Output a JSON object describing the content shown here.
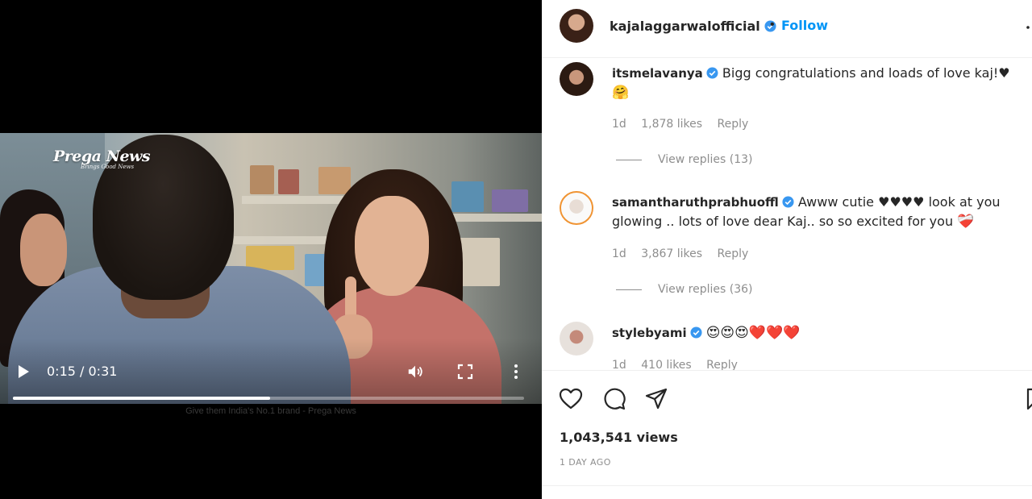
{
  "video": {
    "logo_text": "Prega News",
    "logo_tagline": "Brings Good News",
    "time": "0:15 / 0:31",
    "progress": 0.503,
    "caption": "Give them India's No.1 brand - Prega News"
  },
  "header": {
    "username": "kajalaggarwalofficial",
    "dot": "•",
    "follow_label": "Follow"
  },
  "comments": [
    {
      "username": "itsmelavanya",
      "text": "Bigg congratulations and loads of love kaj!♥",
      "emoji": "🤗",
      "age": "1d",
      "likes": "1,878 likes",
      "reply_label": "Reply",
      "view_replies": "View replies (13)"
    },
    {
      "username": "samantharuthprabhuoffl",
      "text": "Awww cutie ♥♥♥♥ look at you glowing .. lots of love dear Kaj.. so so excited for you",
      "emoji": "❤️‍🩹",
      "age": "1d",
      "likes": "3,867 likes",
      "reply_label": "Reply",
      "view_replies": "View replies (36)"
    },
    {
      "username": "stylebyami",
      "text": "",
      "emoji": "😍😍😍❤️❤️❤️",
      "age": "1d",
      "likes": "410 likes",
      "reply_label": "Reply"
    }
  ],
  "footer": {
    "views": "1,043,541 views",
    "time_ago": "1 DAY AGO"
  },
  "icons": {
    "like": "heart-icon",
    "comment": "comment-icon",
    "share": "share-icon",
    "save": "bookmark-icon",
    "play": "play-icon",
    "volume": "volume-icon",
    "fullscreen": "fullscreen-icon",
    "more": "more-vertical-icon"
  },
  "colors": {
    "accent": "#0095f6",
    "verified": "#3897f0",
    "muted": "#8e8e8e"
  }
}
